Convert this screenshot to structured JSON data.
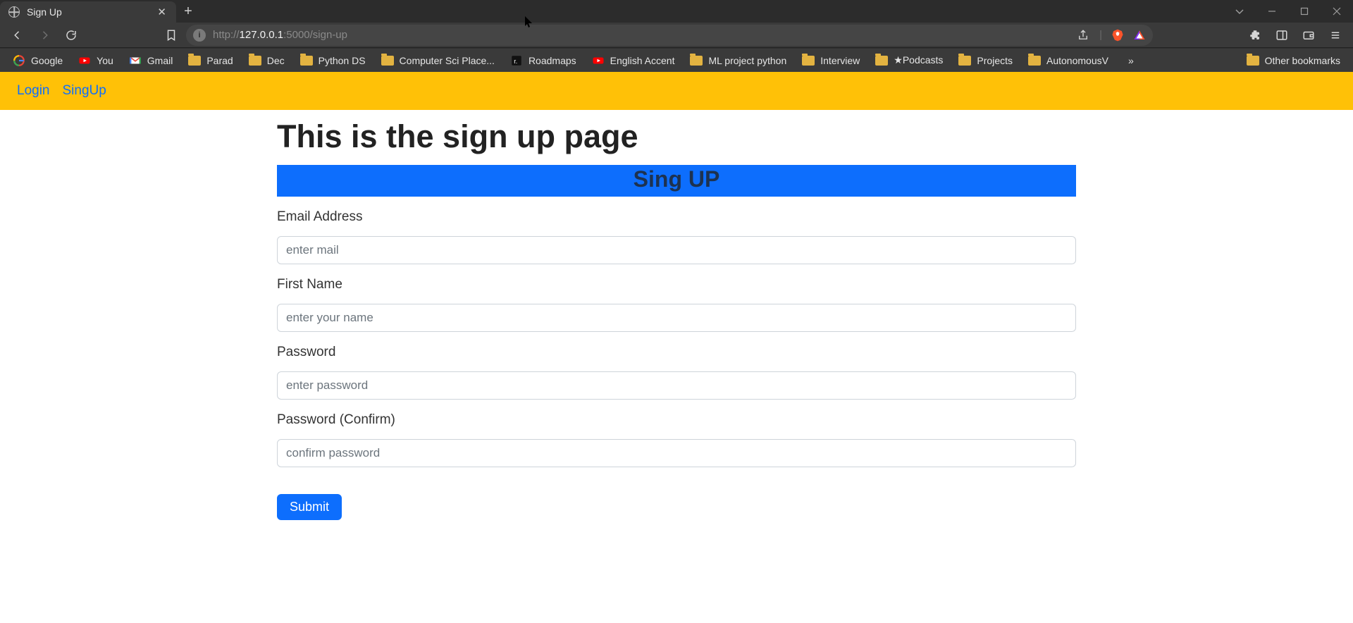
{
  "browser": {
    "tab_title": "Sign Up",
    "url_prefix": "http://",
    "url_host": "127.0.0.1",
    "url_port_path": ":5000/sign-up",
    "bookmarks": [
      {
        "icon": "google",
        "label": "Google"
      },
      {
        "icon": "youtube",
        "label": "You"
      },
      {
        "icon": "gmail",
        "label": "Gmail"
      },
      {
        "icon": "folder",
        "label": "Parad"
      },
      {
        "icon": "folder",
        "label": "Dec"
      },
      {
        "icon": "folder",
        "label": "Python DS"
      },
      {
        "icon": "folder",
        "label": "Computer Sci Place..."
      },
      {
        "icon": "roadmap",
        "label": "Roadmaps"
      },
      {
        "icon": "youtube",
        "label": "English Accent"
      },
      {
        "icon": "folder",
        "label": "ML project python"
      },
      {
        "icon": "folder",
        "label": "Interview"
      },
      {
        "icon": "folder",
        "label": "★Podcasts"
      },
      {
        "icon": "folder",
        "label": "Projects"
      },
      {
        "icon": "folder",
        "label": "AutonomousV"
      }
    ],
    "overflow_glyph": "»",
    "other_bookmarks_label": "Other bookmarks"
  },
  "page": {
    "nav": {
      "login": "Login",
      "signup": "SingUp"
    },
    "heading": "This is the sign up page",
    "banner": "Sing UP",
    "fields": {
      "email": {
        "label": "Email Address",
        "placeholder": "enter mail"
      },
      "first": {
        "label": "First Name",
        "placeholder": "enter your name"
      },
      "pass": {
        "label": "Password",
        "placeholder": "enter password"
      },
      "confirm": {
        "label": "Password (Confirm)",
        "placeholder": "confirm password"
      }
    },
    "submit_label": "Submit"
  }
}
